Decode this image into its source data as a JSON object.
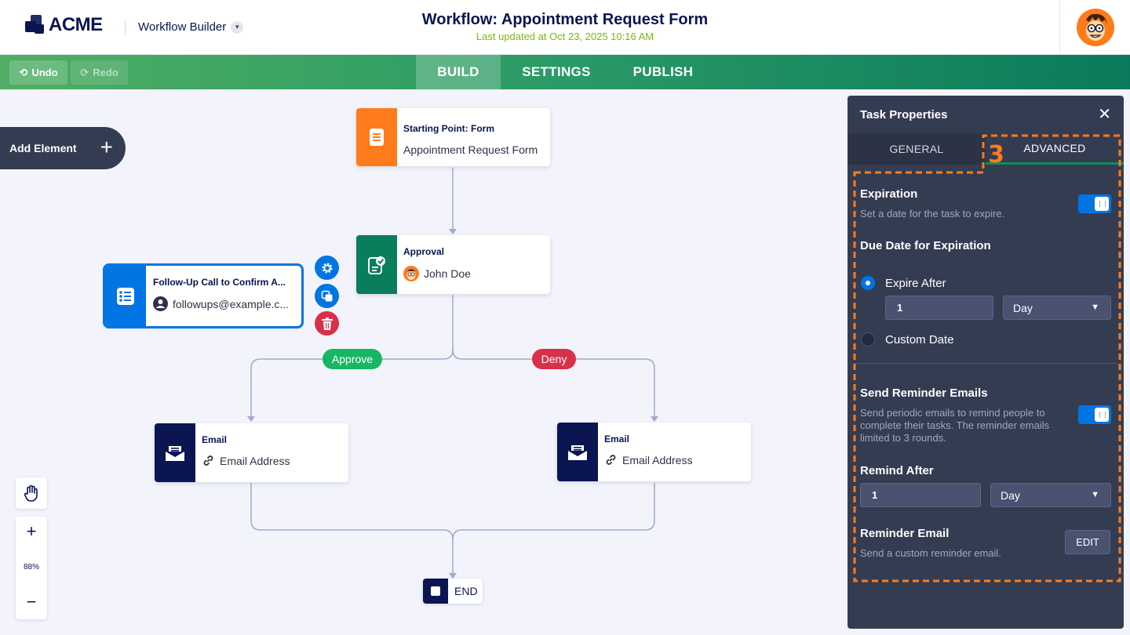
{
  "header": {
    "logo_text": "ACME",
    "builder_label": "Workflow Builder",
    "title": "Workflow: Appointment Request Form",
    "last_updated": "Last updated at Oct 23, 2025 10:16 AM"
  },
  "toolbar": {
    "undo_label": "Undo",
    "redo_label": "Redo",
    "tabs": [
      "BUILD",
      "SETTINGS",
      "PUBLISH"
    ],
    "active_tab": "BUILD"
  },
  "canvas": {
    "add_element_label": "Add Element",
    "nodes": {
      "start": {
        "title": "Starting Point: Form",
        "subtitle": "Appointment Request Form",
        "icon": "form-icon"
      },
      "approval": {
        "title": "Approval",
        "subtitle": "John Doe",
        "icon": "approval-icon"
      },
      "followup": {
        "title": "Follow-Up Call to Confirm A...",
        "subtitle": "followups@example.c...",
        "icon": "checklist-icon"
      },
      "email_left": {
        "title": "Email",
        "subtitle": "Email Address",
        "icon": "email-icon"
      },
      "email_right": {
        "title": "Email",
        "subtitle": "Email Address",
        "icon": "email-icon"
      },
      "end": {
        "label": "END"
      }
    },
    "branches": {
      "approve": "Approve",
      "deny": "Deny"
    },
    "zoom_level": "88%",
    "colors": {
      "form": "#ff7b1c",
      "approval": "#0a7d5c",
      "task": "#0075e3",
      "email": "#0a1551",
      "approve": "#18b663",
      "deny": "#d9304a"
    }
  },
  "panel": {
    "title": "Task Properties",
    "tabs": {
      "general": "GENERAL",
      "advanced": "ADVANCED"
    },
    "step_marker": "3",
    "expiration": {
      "label": "Expiration",
      "description": "Set a date for the task to expire.",
      "enabled": true
    },
    "due_date": {
      "label": "Due Date for Expiration",
      "option_after": "Expire After",
      "option_custom": "Custom Date",
      "selected": "Expire After",
      "amount": "1",
      "unit": "Day"
    },
    "reminders": {
      "label": "Send Reminder Emails",
      "description": "Send periodic emails to remind people to complete their tasks. The reminder emails limited to 3 rounds.",
      "enabled": true
    },
    "remind_after": {
      "label": "Remind After",
      "amount": "1",
      "unit": "Day"
    },
    "reminder_email": {
      "label": "Reminder Email",
      "description": "Send a custom reminder email.",
      "edit_label": "EDIT"
    }
  }
}
